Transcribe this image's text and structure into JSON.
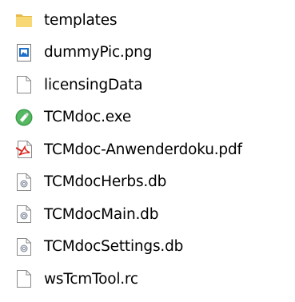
{
  "files": [
    {
      "name": "templates",
      "icon": "folder-icon",
      "type": "folder"
    },
    {
      "name": "dummyPic.png",
      "icon": "image-file-icon",
      "type": "image"
    },
    {
      "name": "licensingData",
      "icon": "blank-file-icon",
      "type": "file"
    },
    {
      "name": "TCMdoc.exe",
      "icon": "exe-app-icon",
      "type": "exe"
    },
    {
      "name": "TCMdoc-Anwenderdoku.pdf",
      "icon": "pdf-file-icon",
      "type": "pdf"
    },
    {
      "name": "TCMdocHerbs.db",
      "icon": "db-file-icon",
      "type": "db"
    },
    {
      "name": "TCMdocMain.db",
      "icon": "db-file-icon",
      "type": "db"
    },
    {
      "name": "TCMdocSettings.db",
      "icon": "db-file-icon",
      "type": "db"
    },
    {
      "name": "wsTcmTool.rc",
      "icon": "blank-file-icon",
      "type": "file"
    }
  ],
  "colors": {
    "folder": "#f8d775",
    "folder_dark": "#e8b84a",
    "image_blue": "#1e6fc8",
    "exe_green": "#3a9d4a",
    "pdf_red": "#d9251d",
    "file_outline": "#8a8a8a"
  }
}
